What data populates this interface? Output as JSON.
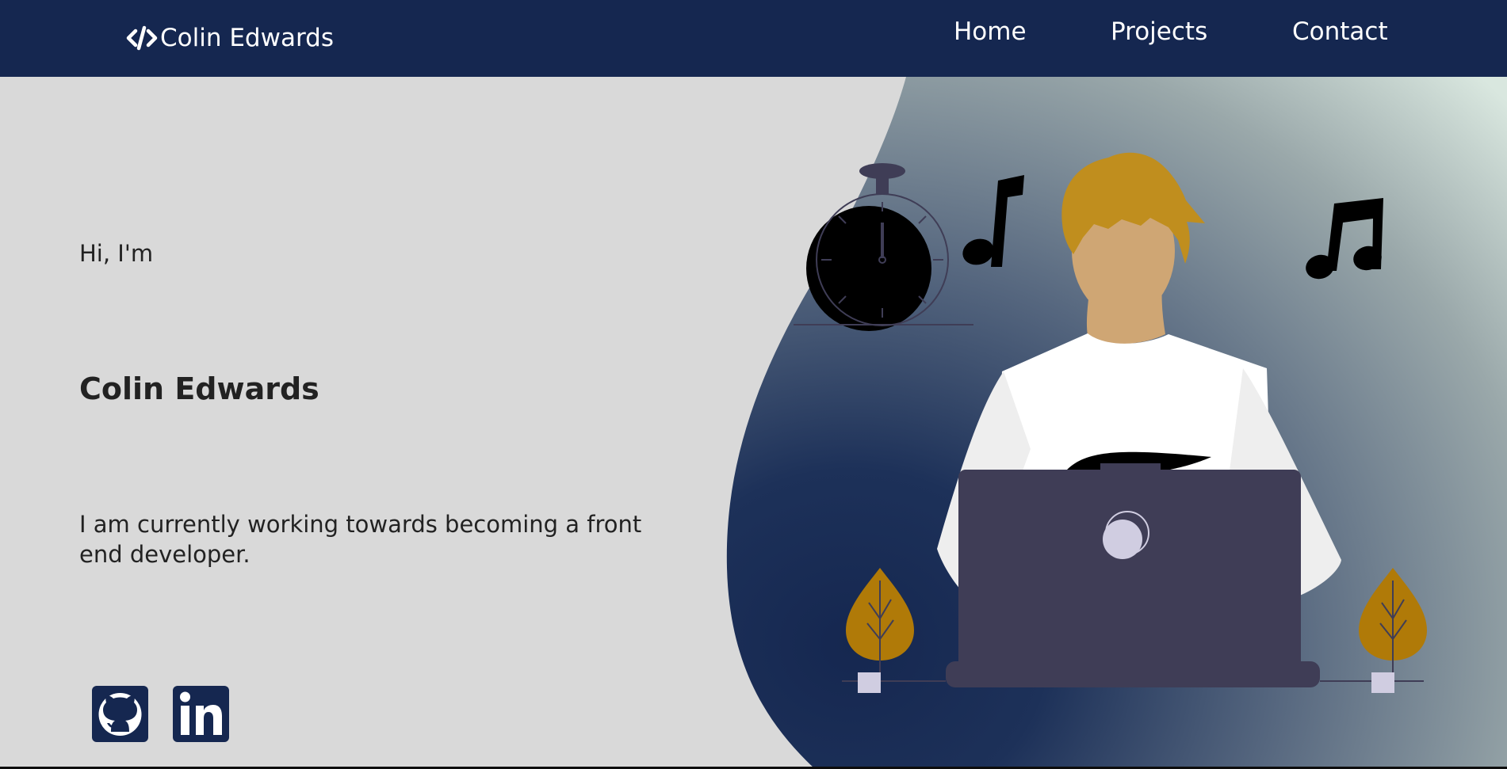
{
  "navbar": {
    "brand_name": "Colin Edwards",
    "brand_icon": "code-slash-icon",
    "links": [
      {
        "label": "Home"
      },
      {
        "label": "Projects"
      },
      {
        "label": "Contact"
      }
    ],
    "background": "#152750"
  },
  "hero": {
    "greeting": "Hi, I'm",
    "name": "Colin Edwards",
    "intro": "I am currently working towards becoming a front end developer.",
    "social": [
      {
        "name": "github-icon"
      },
      {
        "name": "linkedin-icon"
      }
    ],
    "illustration": "developer-at-laptop-illustration",
    "colors": {
      "page_background": "#d9d9d9",
      "accent": "#152750",
      "hair": "#c08e1e",
      "skin": "#cfa674",
      "laptop": "#3f3d56",
      "plant": "#b07a08"
    }
  }
}
